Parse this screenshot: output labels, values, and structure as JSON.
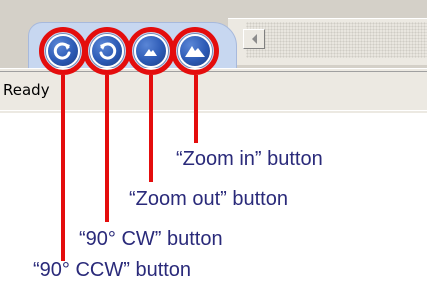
{
  "status_bar": {
    "text": "Ready"
  },
  "toolbar": {
    "buttons": [
      {
        "label": "90° CCW",
        "icon": "rotate-ccw-icon"
      },
      {
        "label": "90° CW",
        "icon": "rotate-cw-icon"
      },
      {
        "label": "Zoom out",
        "icon": "mountain-small-icon"
      },
      {
        "label": "Zoom in",
        "icon": "mountain-large-icon"
      }
    ]
  },
  "callouts": {
    "zoom_in": "“Zoom in” button",
    "zoom_out": "“Zoom out” button",
    "rotate_cw": "“90° CW” button",
    "rotate_ccw": "“90° CCW” button"
  },
  "colors": {
    "highlight": "#e40d0d",
    "callout_text": "#2a2a7a",
    "tab_blue": "#c7d7f0",
    "button_blue": "#2c5ab5"
  }
}
